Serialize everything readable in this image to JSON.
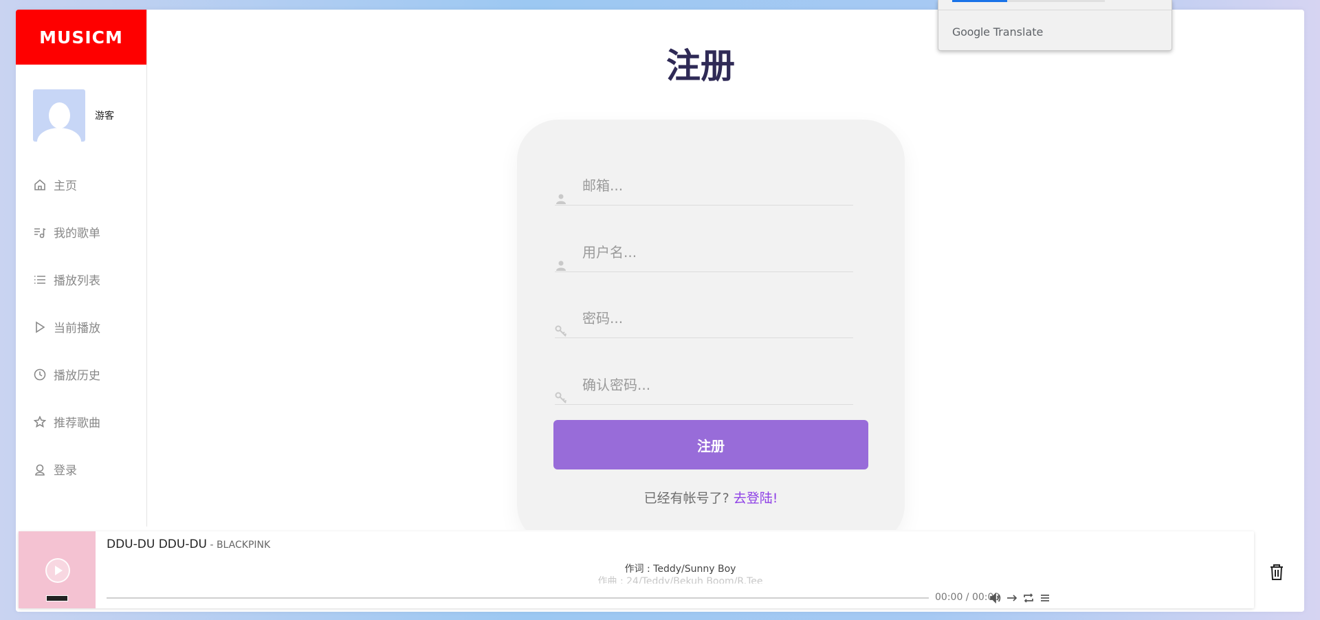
{
  "app": {
    "logo": "MUSICM",
    "brand_color": "#fe0000",
    "accent": "#986cd9"
  },
  "user": {
    "name": "游客"
  },
  "sidebar": {
    "items": [
      {
        "label": "主页",
        "icon": "home-icon"
      },
      {
        "label": "我的歌单",
        "icon": "playlist-music-icon"
      },
      {
        "label": "播放列表",
        "icon": "list-icon"
      },
      {
        "label": "当前播放",
        "icon": "play-icon"
      },
      {
        "label": "播放历史",
        "icon": "clock-icon"
      },
      {
        "label": "推荐歌曲",
        "icon": "star-icon"
      },
      {
        "label": "登录",
        "icon": "login-user-icon"
      }
    ]
  },
  "register": {
    "title": "注册",
    "email_placeholder": "邮箱...",
    "username_placeholder": "用户名...",
    "password_placeholder": "密码...",
    "confirm_placeholder": "确认密码...",
    "submit_label": "注册",
    "hint_text": "已经有帐号了?",
    "login_link": "去登陆!"
  },
  "player": {
    "song_title": "DDU-DU DDU-DU",
    "artist": " - BLACKPINK",
    "lyric_line1": "作词 : Teddy/Sunny Boy",
    "lyric_line2": "作曲 : 24/Teddy/Bekuh Boom/R.Tee",
    "time": "00:00 / 00:00",
    "progress": 0
  },
  "translate_popup": {
    "brand": "Google",
    "product": "Translate"
  }
}
